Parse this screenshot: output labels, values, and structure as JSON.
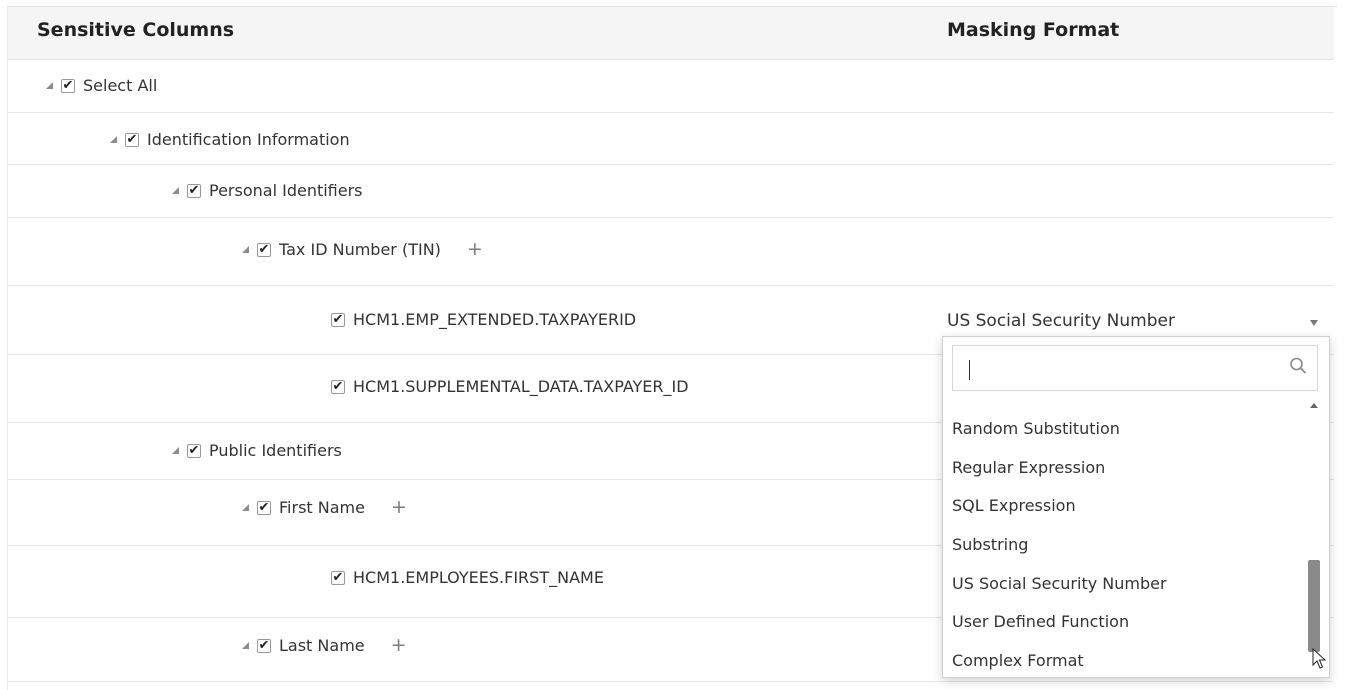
{
  "header": {
    "sensitive_columns": "Sensitive Columns",
    "masking_format": "Masking Format"
  },
  "tree": {
    "select_all": "Select All",
    "identification_information": "Identification Information",
    "personal_identifiers": "Personal Identifiers",
    "tax_id": "Tax ID Number (TIN)",
    "col_taxpayerid": "HCM1.EMP_EXTENDED.TAXPAYERID",
    "col_supplemental": "HCM1.SUPPLEMENTAL_DATA.TAXPAYER_ID",
    "public_identifiers": "Public Identifiers",
    "first_name": "First Name",
    "col_first_name": "HCM1.EMPLOYEES.FIRST_NAME",
    "last_name": "Last Name",
    "plus_glyph": "+",
    "check_glyph": "✔"
  },
  "masking": {
    "selected": "US Social Security Number"
  },
  "dropdown": {
    "search_value": "",
    "options": [
      "Random Substitution",
      "Regular Expression",
      "SQL Expression",
      "Substring",
      "US Social Security Number",
      "User Defined Function",
      "Complex Format"
    ]
  },
  "icons": {
    "search": "search-icon",
    "expand": "triangle-expanded-icon",
    "add": "plus-icon",
    "dropdown": "chevron-down-icon"
  }
}
